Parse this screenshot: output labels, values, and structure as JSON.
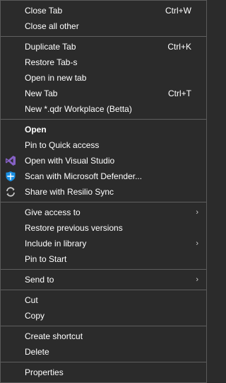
{
  "menu": {
    "items": [
      {
        "label": "Close Tab",
        "shortcut": "Ctrl+W"
      },
      {
        "label": "Close all other"
      },
      {
        "label": "Duplicate Tab",
        "shortcut": "Ctrl+K"
      },
      {
        "label": "Restore Tab-s"
      },
      {
        "label": "Open in new tab"
      },
      {
        "label": "New Tab",
        "shortcut": "Ctrl+T"
      },
      {
        "label": "New *.qdr Workplace (Betta)"
      },
      {
        "label": "Open"
      },
      {
        "label": "Pin to Quick access"
      },
      {
        "label": "Open with Visual Studio",
        "icon": "visual-studio-icon"
      },
      {
        "label": "Scan with Microsoft Defender...",
        "icon": "microsoft-defender-icon"
      },
      {
        "label": "Share with Resilio Sync",
        "icon": "resilio-sync-icon"
      },
      {
        "label": "Give access to",
        "submenu": true
      },
      {
        "label": "Restore previous versions"
      },
      {
        "label": "Include in library",
        "submenu": true
      },
      {
        "label": "Pin to Start"
      },
      {
        "label": "Send to",
        "submenu": true
      },
      {
        "label": "Cut"
      },
      {
        "label": "Copy"
      },
      {
        "label": "Create shortcut"
      },
      {
        "label": "Delete"
      },
      {
        "label": "Properties"
      }
    ],
    "submenu_arrow": "›"
  },
  "colors": {
    "background": "#2b2b2b",
    "separator": "#5f5f5f",
    "text": "#ffffff",
    "visual_studio": "#8661c5",
    "defender": "#1a8fe3"
  }
}
